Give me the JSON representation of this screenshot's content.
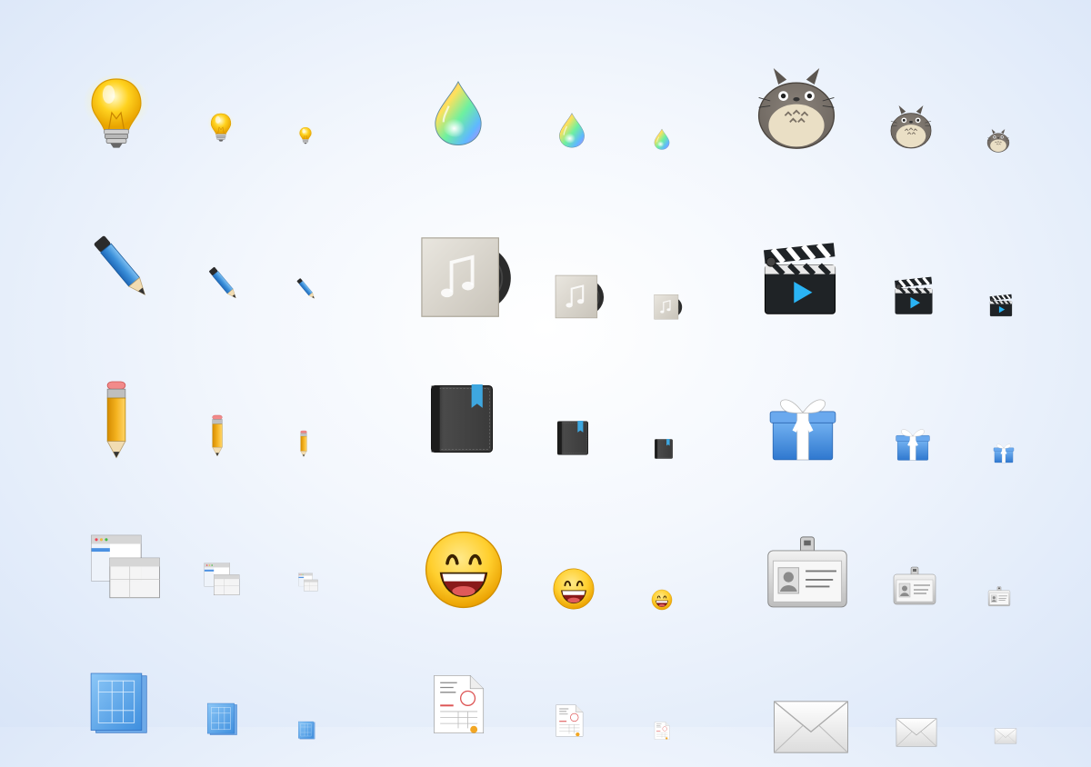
{
  "sheet": {
    "title": "",
    "groups": [
      {
        "id": "lightbulb",
        "name": "lightbulb-icon",
        "sizes": [
          "large",
          "medium",
          "small"
        ]
      },
      {
        "id": "color-drop",
        "name": "color-drop-icon",
        "sizes": [
          "large",
          "medium",
          "small"
        ]
      },
      {
        "id": "totoro",
        "name": "totoro-icon",
        "sizes": [
          "large",
          "medium",
          "small"
        ]
      },
      {
        "id": "pen",
        "name": "blue-pen-icon",
        "sizes": [
          "large",
          "medium",
          "small"
        ]
      },
      {
        "id": "music-album",
        "name": "music-album-icon",
        "sizes": [
          "large",
          "medium",
          "small"
        ]
      },
      {
        "id": "clapperboard",
        "name": "clapperboard-video-icon",
        "sizes": [
          "large",
          "medium",
          "small"
        ]
      },
      {
        "id": "pencil",
        "name": "pencil-icon",
        "sizes": [
          "large",
          "medium",
          "small"
        ]
      },
      {
        "id": "book",
        "name": "bookmarked-book-icon",
        "sizes": [
          "large",
          "medium",
          "small"
        ]
      },
      {
        "id": "gift",
        "name": "gift-box-icon",
        "sizes": [
          "large",
          "medium",
          "small"
        ]
      },
      {
        "id": "windows",
        "name": "app-windows-icon",
        "sizes": [
          "large",
          "medium",
          "small"
        ]
      },
      {
        "id": "smiley",
        "name": "smiley-face-icon",
        "sizes": [
          "large",
          "medium",
          "small"
        ]
      },
      {
        "id": "id-badge",
        "name": "id-badge-icon",
        "sizes": [
          "large",
          "medium",
          "small"
        ]
      },
      {
        "id": "blueprint",
        "name": "blueprint-icon",
        "sizes": [
          "large",
          "medium",
          "small"
        ]
      },
      {
        "id": "invoice",
        "name": "invoice-document-icon",
        "sizes": [
          "large",
          "medium",
          "small"
        ]
      },
      {
        "id": "envelope",
        "name": "mail-envelope-icon",
        "sizes": [
          "large",
          "medium",
          "small"
        ]
      }
    ]
  },
  "colors": {
    "background": "#eef3fb",
    "bulb": "#ffd21f",
    "pen_blue": "#3b8fd9",
    "pencil_yellow": "#f4b21f",
    "book_dark": "#3a3a3a",
    "bookmark_blue": "#3ea7e0",
    "gift_blue": "#4a93e0",
    "smiley_yellow": "#ffcf2e",
    "totoro_gray": "#6e6760",
    "clapper_black": "#1f2326",
    "play_blue": "#2ab4f5"
  }
}
